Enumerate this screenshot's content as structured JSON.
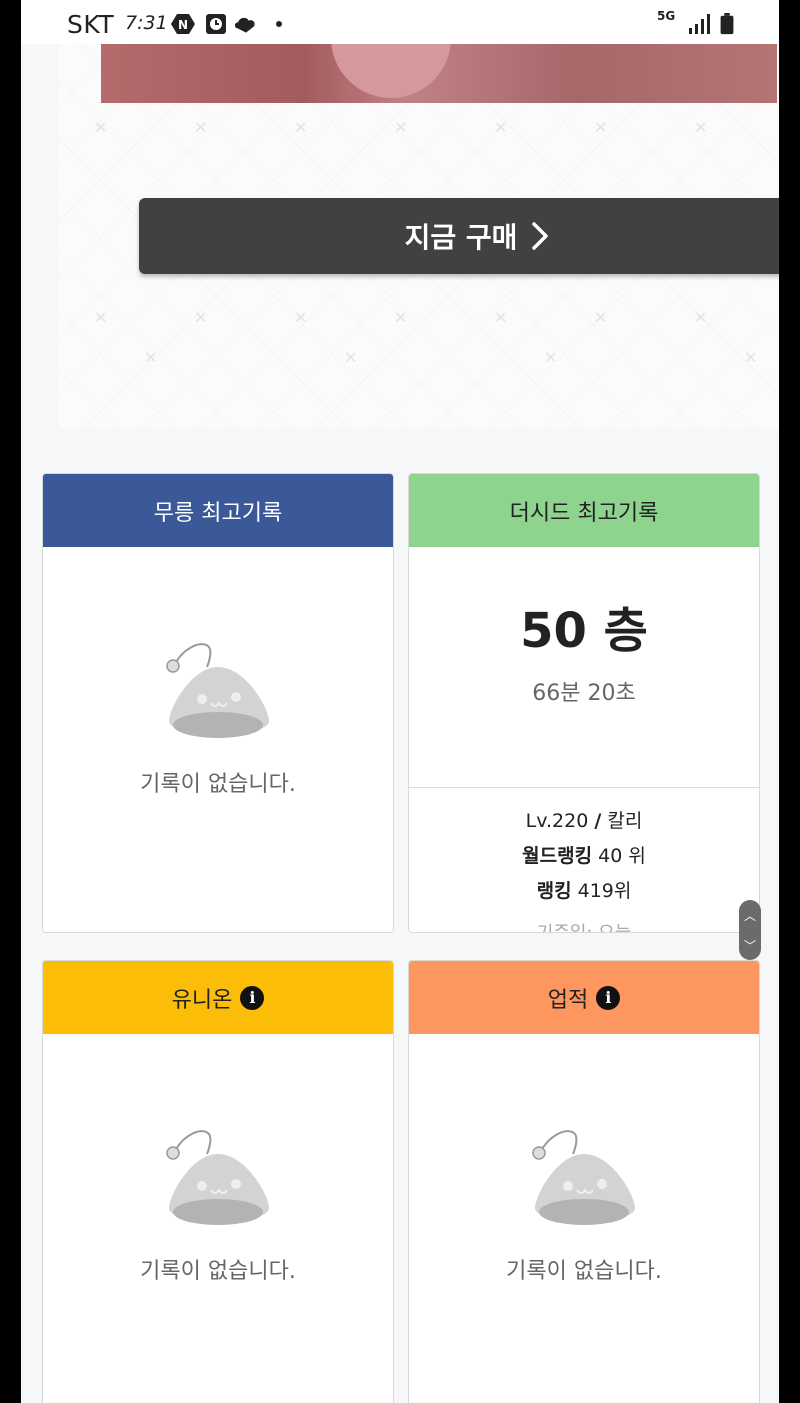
{
  "status_bar": {
    "carrier": "SKT",
    "time": "7:31",
    "network": "5G",
    "icons": [
      "n-badge-icon",
      "clock-app-icon",
      "cloud-app-icon",
      "notification-dot-icon",
      "signal-icon",
      "battery-icon"
    ]
  },
  "ad": {
    "buy_label": "지금 구매"
  },
  "cards": {
    "mureung": {
      "title": "무릉 최고기록",
      "empty_text": "기록이 없습니다.",
      "color": "#3b5998"
    },
    "seed": {
      "title": "더시드 최고기록",
      "color": "#8fd48e",
      "floor": "50 층",
      "time": "66분 20초",
      "level_job_prefix": "Lv.220",
      "level_job_sep": "/",
      "job": "칼리",
      "world_ranking_label": "월드랭킹",
      "world_ranking_value": "40 위",
      "ranking_label": "랭킹",
      "ranking_value": "419위",
      "base_date": "기준일: 오늘"
    },
    "union": {
      "title": "유니온",
      "empty_text": "기록이 없습니다.",
      "color": "#fbbd08"
    },
    "achievement": {
      "title": "업적",
      "empty_text": "기록이 없습니다.",
      "color": "#fe9660"
    }
  }
}
